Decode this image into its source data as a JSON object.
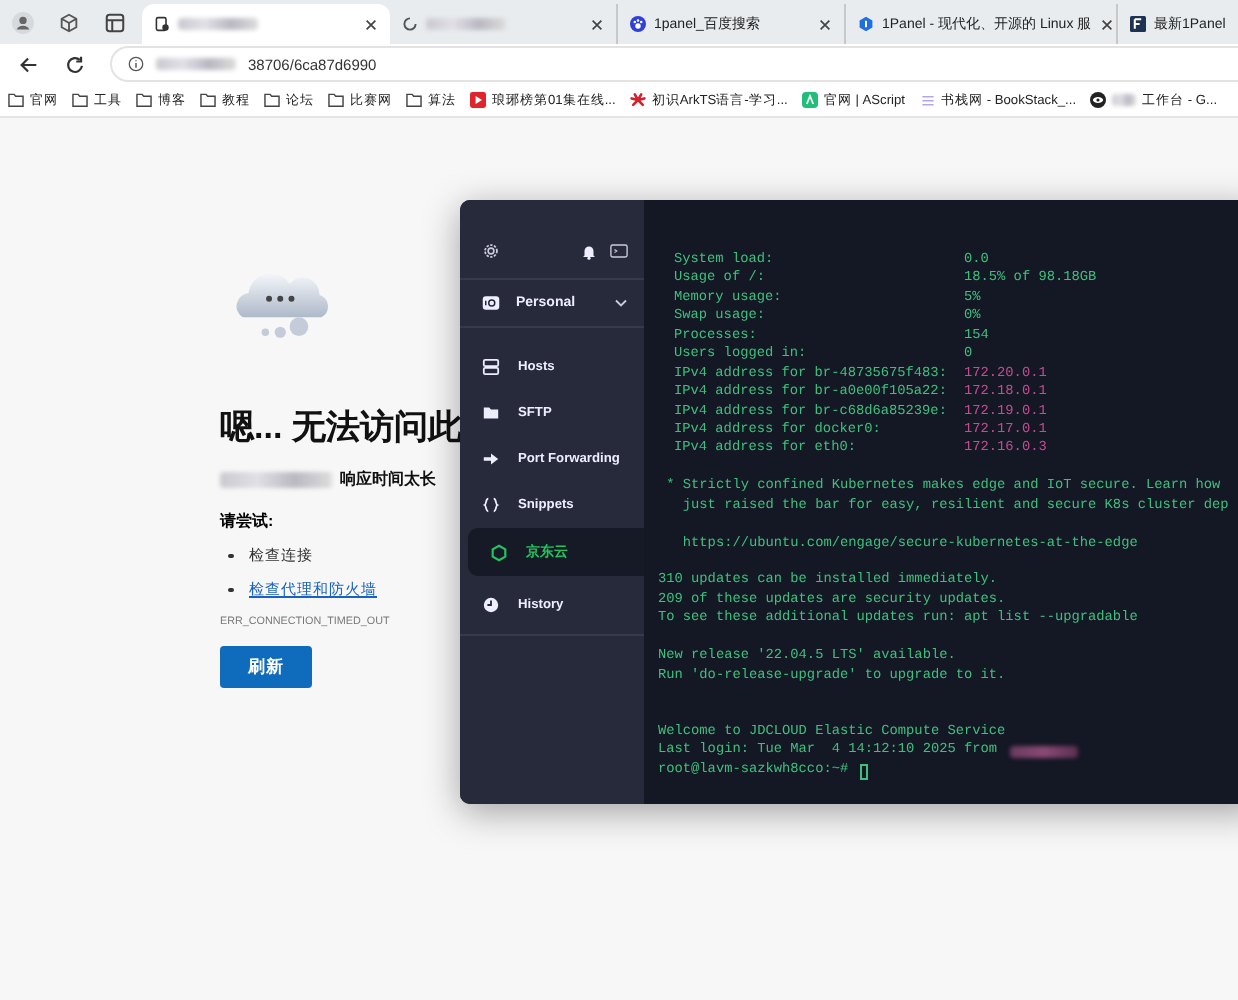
{
  "browser": {
    "tabs": [
      {
        "kind": "page",
        "title_redacted": true,
        "selected": true
      },
      {
        "kind": "loading",
        "title_redacted": true,
        "selected": false
      },
      {
        "kind": "paw",
        "title": "1panel_百度搜索",
        "selected": false
      },
      {
        "kind": "info",
        "title": "1Panel - 现代化、开源的 Linux 服",
        "selected": false
      },
      {
        "kind": "square",
        "title": "最新1Panel",
        "selected": false
      }
    ],
    "address": {
      "host_redacted": true,
      "text": "38706/6ca87d6990"
    },
    "bookmarks": [
      {
        "kind": "folder",
        "label": "官网"
      },
      {
        "kind": "folder",
        "label": "工具"
      },
      {
        "kind": "folder",
        "label": "博客"
      },
      {
        "kind": "folder",
        "label": "教程"
      },
      {
        "kind": "folder",
        "label": "论坛"
      },
      {
        "kind": "folder",
        "label": "比赛网"
      },
      {
        "kind": "folder",
        "label": "算法"
      },
      {
        "kind": "play",
        "label": "琅琊榜第01集在线..."
      },
      {
        "kind": "flower",
        "label": "初识ArkTS语言-学习..."
      },
      {
        "kind": "green",
        "label": "官网 | AScript"
      },
      {
        "kind": "doc",
        "label": "书栈网 - BookStack_..."
      },
      {
        "kind": "eye",
        "label": "工作台 - G...",
        "redacted_prefix": true
      }
    ]
  },
  "error_page": {
    "title": "嗯... 无法访问此",
    "subtitle": "响应时间太长",
    "subtitle_host_redacted": true,
    "try_label": "请尝试:",
    "suggestions": [
      {
        "text": "检查连接",
        "link": false
      },
      {
        "text": "检查代理和防火墙",
        "link": true
      }
    ],
    "code": "ERR_CONNECTION_TIMED_OUT",
    "button": "刷新"
  },
  "ssh_app": {
    "vault": "Personal",
    "nav": [
      {
        "kind": "hosts",
        "label": "Hosts",
        "selected": false
      },
      {
        "kind": "folder",
        "label": "SFTP",
        "selected": false
      },
      {
        "kind": "arrow",
        "label": "Port Forwarding",
        "selected": false
      },
      {
        "kind": "braces",
        "label": "Snippets",
        "selected": false
      }
    ],
    "sessions": [
      {
        "label": "京东云",
        "selected": true
      }
    ],
    "history": {
      "label": "History"
    },
    "terminal": [
      {
        "kind": "kv",
        "key": "System load:",
        "value": "0.0"
      },
      {
        "kind": "kv",
        "key": "Usage of /:",
        "value": "18.5% of 98.18GB"
      },
      {
        "kind": "kv",
        "key": "Memory usage:",
        "value": "5%"
      },
      {
        "kind": "kv",
        "key": "Swap usage:",
        "value": "0%"
      },
      {
        "kind": "kv",
        "key": "Processes:",
        "value": "154"
      },
      {
        "kind": "kv",
        "key": "Users logged in:",
        "value": "0"
      },
      {
        "kind": "ip",
        "key": "IPv4 address for br-48735675f483:",
        "value": "172.20.0.1"
      },
      {
        "kind": "ip",
        "key": "IPv4 address for br-a0e00f105a22:",
        "value": "172.18.0.1"
      },
      {
        "kind": "ip",
        "key": "IPv4 address for br-c68d6a85239e:",
        "value": "172.19.0.1"
      },
      {
        "kind": "ip",
        "key": "IPv4 address for docker0:",
        "value": "172.17.0.1"
      },
      {
        "kind": "ip",
        "key": "IPv4 address for eth0:",
        "value": "172.16.0.3"
      },
      {
        "kind": "blank"
      },
      {
        "kind": "text",
        "text": " * Strictly confined Kubernetes makes edge and IoT secure. Learn how"
      },
      {
        "kind": "text",
        "text": "   just raised the bar for easy, resilient and secure K8s cluster dep"
      },
      {
        "kind": "blank"
      },
      {
        "kind": "text",
        "text": "   https://ubuntu.com/engage/secure-kubernetes-at-the-edge"
      },
      {
        "kind": "blank"
      },
      {
        "kind": "text",
        "text": "310 updates can be installed immediately."
      },
      {
        "kind": "text",
        "text": "209 of these updates are security updates."
      },
      {
        "kind": "text",
        "text": "To see these additional updates run: apt list --upgradable"
      },
      {
        "kind": "blank"
      },
      {
        "kind": "text",
        "text": "New release '22.04.5 LTS' available."
      },
      {
        "kind": "text",
        "text": "Run 'do-release-upgrade' to upgrade to it."
      },
      {
        "kind": "blank"
      },
      {
        "kind": "blank"
      },
      {
        "kind": "text",
        "text": "Welcome to JDCLOUD Elastic Compute Service"
      },
      {
        "kind": "login",
        "text": "Last login: Tue Mar  4 14:12:10 2025 from",
        "host_redacted": true
      },
      {
        "kind": "prompt",
        "text": "root@lavm-sazkwh8cco:~#"
      }
    ]
  }
}
